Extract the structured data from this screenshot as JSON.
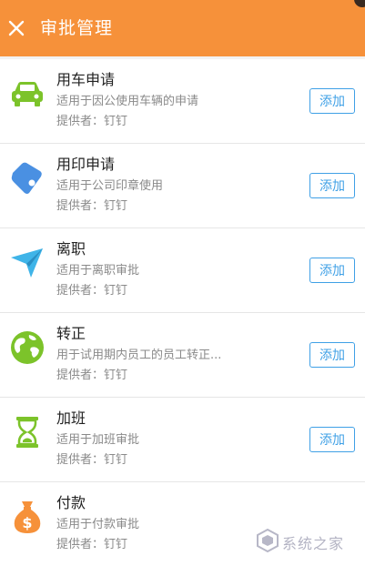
{
  "header": {
    "title": "审批管理",
    "close_icon": "close-icon",
    "background": "#f6913a"
  },
  "items": [
    {
      "name": "用车申请",
      "desc": "适用于因公使用车辆的申请",
      "provider": "提供者：钉钉",
      "action": "添加",
      "icon": "car-icon",
      "icon_color": "#7cc32a"
    },
    {
      "name": "用印申请",
      "desc": "适用于公司印章使用",
      "provider": "提供者：钉钉",
      "action": "添加",
      "icon": "tag-icon",
      "icon_color": "#4a90e2"
    },
    {
      "name": "离职",
      "desc": "适用于离职审批",
      "provider": "提供者：钉钉",
      "action": "添加",
      "icon": "paper-plane-icon",
      "icon_color": "#3fb4e8"
    },
    {
      "name": "转正",
      "desc": "用于试用期内员工的员工转正...",
      "provider": "提供者：钉钉",
      "action": "添加",
      "icon": "globe-icon",
      "icon_color": "#7cc32a"
    },
    {
      "name": "加班",
      "desc": "适用于加班审批",
      "provider": "提供者：钉钉",
      "action": "添加",
      "icon": "hourglass-icon",
      "icon_color": "#7cc32a"
    },
    {
      "name": "付款",
      "desc": "适用于付款审批",
      "provider": "提供者：钉钉",
      "icon": "money-bag-icon",
      "icon_color": "#f6913a"
    }
  ],
  "watermark": {
    "text": "系统之家"
  },
  "colors": {
    "accent": "#3fa0e6",
    "header": "#f6913a"
  }
}
